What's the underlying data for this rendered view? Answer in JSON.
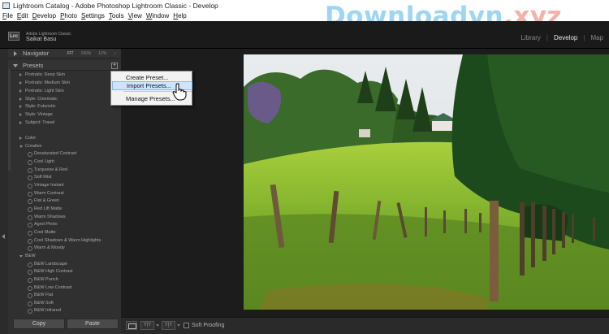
{
  "window": {
    "title": "Lightroom Catalog - Adobe Photoshop Lightroom Classic - Develop",
    "menus": [
      "File",
      "Edit",
      "Develop",
      "Photo",
      "Settings",
      "Tools",
      "View",
      "Window",
      "Help"
    ]
  },
  "watermark": {
    "part1": "Downloadvn",
    "part2": ".xyz",
    "color1": "#9ed5f3",
    "color2": "#f3b2a8"
  },
  "identity_plate": {
    "badge": "Lrc",
    "product": "Adobe Lightroom Classic",
    "user": "Saikat Basu"
  },
  "modules": {
    "items": [
      "Library",
      "Develop",
      "Map"
    ],
    "separator": "|",
    "active": "Develop"
  },
  "navigator": {
    "title": "Navigator",
    "zoom_options": [
      "FIT",
      "100%",
      "12%"
    ],
    "zoom_menu_glyph": "↕"
  },
  "presets": {
    "title": "Presets",
    "add_glyph": "+",
    "groups_collapsed": [
      "Portraits: Deep Skin",
      "Portraits: Medium Skin",
      "Portraits: Light Skin",
      "Style: Cinematic",
      "Style: Futuristic",
      "Style: Vintage",
      "Subject: Travel"
    ],
    "color_group": "Color",
    "creative_group": "Creative",
    "creative_items": [
      "Desaturated Contrast",
      "Cool Light",
      "Turquoise & Red",
      "Soft Mist",
      "Vintage Instant",
      "Warm Contrast",
      "Flat & Green",
      "Red Lift Matte",
      "Warm Shadows",
      "Aged Photo",
      "Cool Matte",
      "Cool Shadows & Warm Highlights",
      "Warm & Moody"
    ],
    "bw_group": "B&W",
    "bw_items": [
      "B&W Landscape",
      "B&W High Contrast",
      "B&W Punch",
      "B&W Low Contrast",
      "B&W Flat",
      "B&W Soft",
      "B&W Infrared"
    ]
  },
  "context_menu": {
    "items": [
      "Create Preset...",
      "Import Presets...",
      "Manage Presets..."
    ],
    "highlighted": "Import Presets..."
  },
  "buttons": {
    "copy": "Copy",
    "paste": "Paste"
  },
  "toolbar": {
    "before_after": "Y|Y",
    "swap": "Y|Y",
    "soft_proofing": "Soft Proofing"
  }
}
